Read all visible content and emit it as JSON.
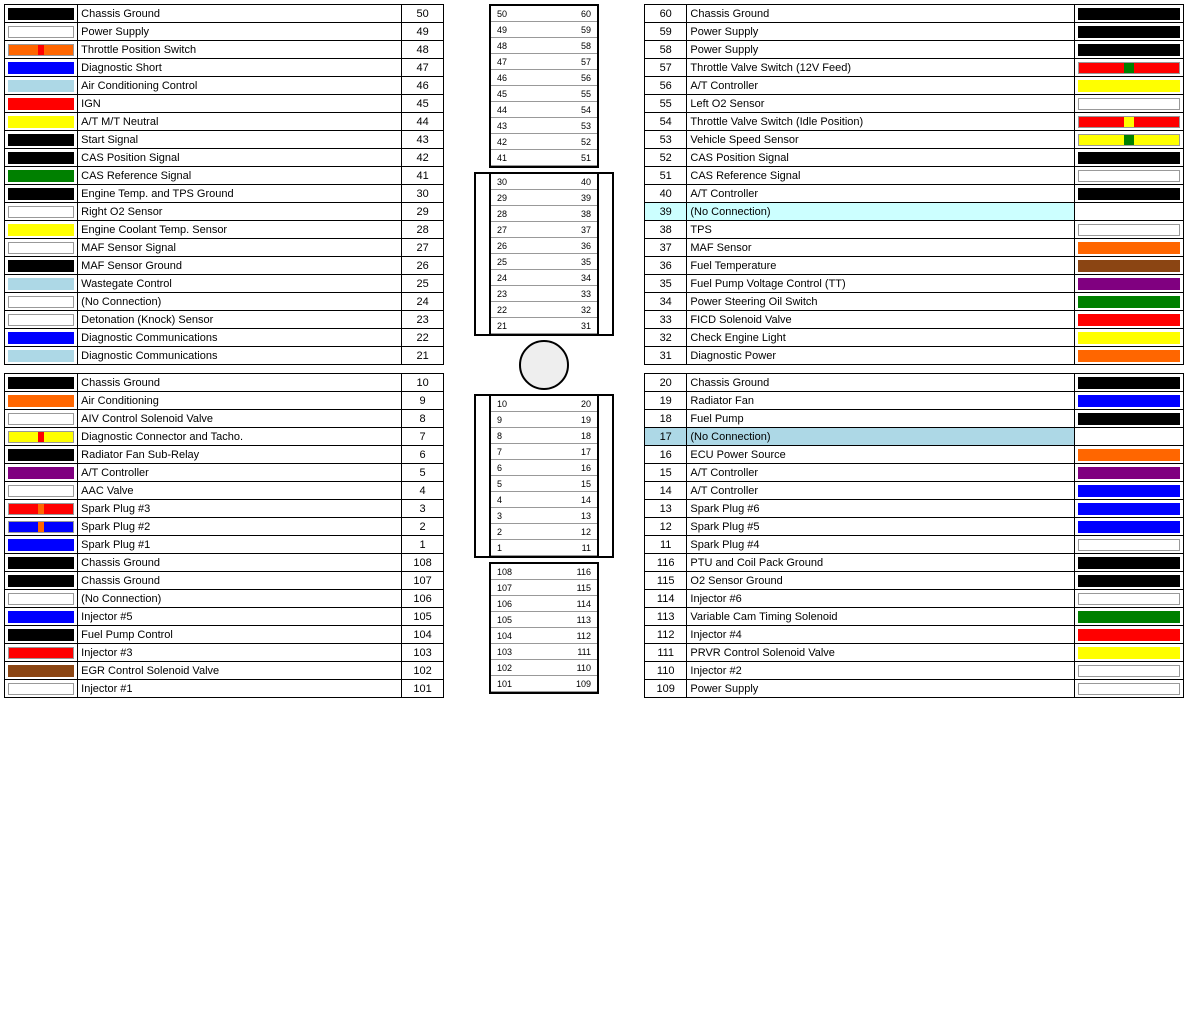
{
  "left": {
    "rows_top": [
      {
        "color": "#000000",
        "color2": null,
        "name": "Chassis Ground",
        "num": "50"
      },
      {
        "color": "#ffffff",
        "color2": null,
        "name": "Power Supply",
        "num": "49"
      },
      {
        "color": "#ff6600",
        "color2": "#ff0000",
        "name": "Throttle Position Switch",
        "num": "48"
      },
      {
        "color": "#0000ff",
        "color2": null,
        "name": "Diagnostic Short",
        "num": "47"
      },
      {
        "color": "#add8e6",
        "color2": null,
        "name": "Air Conditioning Control",
        "num": "46"
      },
      {
        "color": "#ff0000",
        "color2": null,
        "name": "IGN",
        "num": "45"
      },
      {
        "color": "#ffff00",
        "color2": null,
        "name": "A/T M/T Neutral",
        "num": "44"
      },
      {
        "color": "#000000",
        "color2": null,
        "name": "Start Signal",
        "num": "43"
      },
      {
        "color": "#000000",
        "color2": null,
        "name": "CAS Position Signal",
        "num": "42"
      },
      {
        "color": "#008000",
        "color2": null,
        "name": "CAS Reference Signal",
        "num": "41"
      },
      {
        "color": "#000000",
        "color2": null,
        "name": "Engine Temp. and TPS Ground",
        "num": "30"
      },
      {
        "color": "#ffffff",
        "color2": null,
        "name": "Right O2 Sensor",
        "num": "29"
      },
      {
        "color": "#ffff00",
        "color2": null,
        "name": "Engine Coolant Temp. Sensor",
        "num": "28"
      },
      {
        "color": "#ffffff",
        "color2": null,
        "name": "MAF Sensor Signal",
        "num": "27"
      },
      {
        "color": "#000000",
        "color2": null,
        "name": "MAF Sensor Ground",
        "num": "26"
      },
      {
        "color": "#add8e6",
        "color2": null,
        "name": "Wastegate Control",
        "num": "25"
      },
      {
        "color": "#ffffff",
        "color2": null,
        "name": "(No Connection)",
        "num": "24"
      },
      {
        "color": "#ffffff",
        "color2": null,
        "name": "Detonation (Knock) Sensor",
        "num": "23"
      },
      {
        "color": "#0000ff",
        "color2": null,
        "name": "Diagnostic Communications",
        "num": "22"
      },
      {
        "color": "#add8e6",
        "color2": null,
        "name": "Diagnostic Communications",
        "num": "21"
      }
    ],
    "rows_bottom": [
      {
        "color": "#000000",
        "color2": null,
        "name": "Chassis Ground",
        "num": "10"
      },
      {
        "color": "#ff6600",
        "color2": null,
        "name": "Air Conditioning",
        "num": "9"
      },
      {
        "color": "#ffffff",
        "color2": null,
        "name": "AIV Control Solenoid Valve",
        "num": "8"
      },
      {
        "color": "#ffff00",
        "color2": "#ff0000",
        "name": "Diagnostic Connector and Tacho.",
        "num": "7"
      },
      {
        "color": "#000000",
        "color2": null,
        "name": "Radiator Fan Sub-Relay",
        "num": "6"
      },
      {
        "color": "#800080",
        "color2": null,
        "name": "A/T Controller",
        "num": "5"
      },
      {
        "color": "#ffffff",
        "color2": null,
        "name": "AAC Valve",
        "num": "4"
      },
      {
        "color": "#ff0000",
        "color2": "#ff6600",
        "name": "Spark Plug #3",
        "num": "3"
      },
      {
        "color": "#0000ff",
        "color2": "#ff6600",
        "name": "Spark Plug #2",
        "num": "2"
      },
      {
        "color": "#0000ff",
        "color2": null,
        "name": "Spark Plug #1",
        "num": "1"
      },
      {
        "color": "#000000",
        "color2": null,
        "name": "Chassis Ground",
        "num": "108"
      },
      {
        "color": "#000000",
        "color2": null,
        "name": "Chassis Ground",
        "num": "107"
      },
      {
        "color": "#ffffff",
        "color2": null,
        "name": "(No Connection)",
        "num": "106"
      },
      {
        "color": "#0000ff",
        "color2": null,
        "name": "Injector #5",
        "num": "105"
      },
      {
        "color": "#000000",
        "color2": null,
        "name": "Fuel Pump Control",
        "num": "104"
      },
      {
        "color": "#ff0000",
        "color2": "#ff0000",
        "name": "Injector #3",
        "num": "103"
      },
      {
        "color": "#8b4513",
        "color2": null,
        "name": "EGR Control Solenoid Valve",
        "num": "102"
      },
      {
        "color": "#ffffff",
        "color2": null,
        "name": "Injector #1",
        "num": "101"
      }
    ]
  },
  "right": {
    "rows_top": [
      {
        "num": "60",
        "name": "Chassis Ground",
        "color": "#000000",
        "color2": null
      },
      {
        "num": "59",
        "name": "Power Supply",
        "color": "#000000",
        "color2": null
      },
      {
        "num": "58",
        "name": "Power Supply",
        "color": "#000000",
        "color2": null
      },
      {
        "num": "57",
        "name": "Throttle Valve Switch (12V Feed)",
        "color": "#ff0000",
        "color2": "#008000"
      },
      {
        "num": "56",
        "name": "A/T Controller",
        "color": "#ffff00",
        "color2": null
      },
      {
        "num": "55",
        "name": "Left O2 Sensor",
        "color": "#ffffff",
        "color2": null
      },
      {
        "num": "54",
        "name": "Throttle Valve Switch (Idle Position)",
        "color": "#ff0000",
        "color2": "#ffff00"
      },
      {
        "num": "53",
        "name": "Vehicle Speed Sensor",
        "color": "#ffff00",
        "color2": "#008000"
      },
      {
        "num": "52",
        "name": "CAS Position Signal",
        "color": "#000000",
        "color2": null
      },
      {
        "num": "51",
        "name": "CAS Reference Signal",
        "color": "#ffffff",
        "color2": null
      },
      {
        "num": "40",
        "name": "A/T Controller",
        "color": "#000000",
        "color2": null
      },
      {
        "num": "39",
        "name": "(No Connection)",
        "color": null,
        "color2": null,
        "highlight": "#ccffff"
      },
      {
        "num": "38",
        "name": "TPS",
        "color": "#ffffff",
        "color2": null
      },
      {
        "num": "37",
        "name": "MAF Sensor",
        "color": "#ff6600",
        "color2": null
      },
      {
        "num": "36",
        "name": "Fuel Temperature",
        "color": "#8b4513",
        "color2": null
      },
      {
        "num": "35",
        "name": "Fuel Pump Voltage Control (TT)",
        "color": "#800080",
        "color2": null
      },
      {
        "num": "34",
        "name": "Power Steering Oil Switch",
        "color": "#008000",
        "color2": null
      },
      {
        "num": "33",
        "name": "FICD Solenoid Valve",
        "color": "#ff0000",
        "color2": null
      },
      {
        "num": "32",
        "name": "Check Engine Light",
        "color": "#ffff00",
        "color2": null
      },
      {
        "num": "31",
        "name": "Diagnostic Power",
        "color": "#ff6600",
        "color2": null
      }
    ],
    "rows_bottom": [
      {
        "num": "20",
        "name": "Chassis Ground",
        "color": "#000000",
        "color2": null
      },
      {
        "num": "19",
        "name": "Radiator Fan",
        "color": "#0000ff",
        "color2": null
      },
      {
        "num": "18",
        "name": "Fuel Pump",
        "color": "#000000",
        "color2": null
      },
      {
        "num": "17",
        "name": "(No Connection)",
        "color": null,
        "color2": null,
        "highlight": "#add8e6"
      },
      {
        "num": "16",
        "name": "ECU Power Source",
        "color": "#ff6600",
        "color2": null
      },
      {
        "num": "15",
        "name": "A/T Controller",
        "color": "#800080",
        "color2": null
      },
      {
        "num": "14",
        "name": "A/T Controller",
        "color": "#0000ff",
        "color2": null
      },
      {
        "num": "13",
        "name": "Spark Plug #6",
        "color": "#0000ff",
        "color2": null
      },
      {
        "num": "12",
        "name": "Spark Plug #5",
        "color": "#0000ff",
        "color2": null
      },
      {
        "num": "11",
        "name": "Spark Plug #4",
        "color": "#ffffff",
        "color2": null
      },
      {
        "num": "116",
        "name": "PTU and Coil Pack Ground",
        "color": "#000000",
        "color2": null
      },
      {
        "num": "115",
        "name": "O2 Sensor Ground",
        "color": "#000000",
        "color2": null
      },
      {
        "num": "114",
        "name": "Injector #6",
        "color": "#ffffff",
        "color2": null
      },
      {
        "num": "113",
        "name": "Variable Cam Timing Solenoid",
        "color": "#008000",
        "color2": null
      },
      {
        "num": "112",
        "name": "Injector #4",
        "color": "#ff0000",
        "color2": null
      },
      {
        "num": "111",
        "name": "PRVR Control Solenoid Valve",
        "color": "#ffff00",
        "color2": null
      },
      {
        "num": "110",
        "name": "Injector #2",
        "color": "#ffffff",
        "color2": null
      },
      {
        "num": "109",
        "name": "Power Supply",
        "color": "#ffffff",
        "color2": null
      }
    ]
  },
  "center": {
    "top_pins": [
      {
        "left": "50",
        "right": "60"
      },
      {
        "left": "49",
        "right": "59"
      },
      {
        "left": "48",
        "right": "58"
      },
      {
        "left": "47",
        "right": "57"
      },
      {
        "left": "46",
        "right": "56"
      },
      {
        "left": "45",
        "right": "55"
      },
      {
        "left": "44",
        "right": "54"
      },
      {
        "left": "43",
        "right": "53"
      },
      {
        "left": "42",
        "right": "52"
      },
      {
        "left": "41",
        "right": "51"
      }
    ],
    "mid_pins": [
      {
        "left": "30",
        "right": "40"
      },
      {
        "left": "29",
        "right": "39"
      },
      {
        "left": "28",
        "right": "38"
      },
      {
        "left": "27",
        "right": "37"
      },
      {
        "left": "26",
        "right": "36"
      },
      {
        "left": "25",
        "right": "35"
      },
      {
        "left": "24",
        "right": "34"
      },
      {
        "left": "23",
        "right": "33"
      },
      {
        "left": "22",
        "right": "32"
      },
      {
        "left": "21",
        "right": "31"
      }
    ],
    "lower_pins": [
      {
        "left": "10",
        "right": "20"
      },
      {
        "left": "9",
        "right": "19"
      },
      {
        "left": "8",
        "right": "18"
      },
      {
        "left": "7",
        "right": "17"
      },
      {
        "left": "6",
        "right": "16"
      },
      {
        "left": "5",
        "right": "15"
      },
      {
        "left": "4",
        "right": "14"
      },
      {
        "left": "3",
        "right": "13"
      },
      {
        "left": "2",
        "right": "12"
      },
      {
        "left": "1",
        "right": "11"
      }
    ],
    "bottom_pins": [
      {
        "left": "108",
        "right": "116"
      },
      {
        "left": "107",
        "right": "115"
      },
      {
        "left": "106",
        "right": "114"
      },
      {
        "left": "105",
        "right": "113"
      },
      {
        "left": "104",
        "right": "112"
      },
      {
        "left": "103",
        "right": "111"
      },
      {
        "left": "102",
        "right": "110"
      },
      {
        "left": "101",
        "right": "109"
      }
    ]
  }
}
